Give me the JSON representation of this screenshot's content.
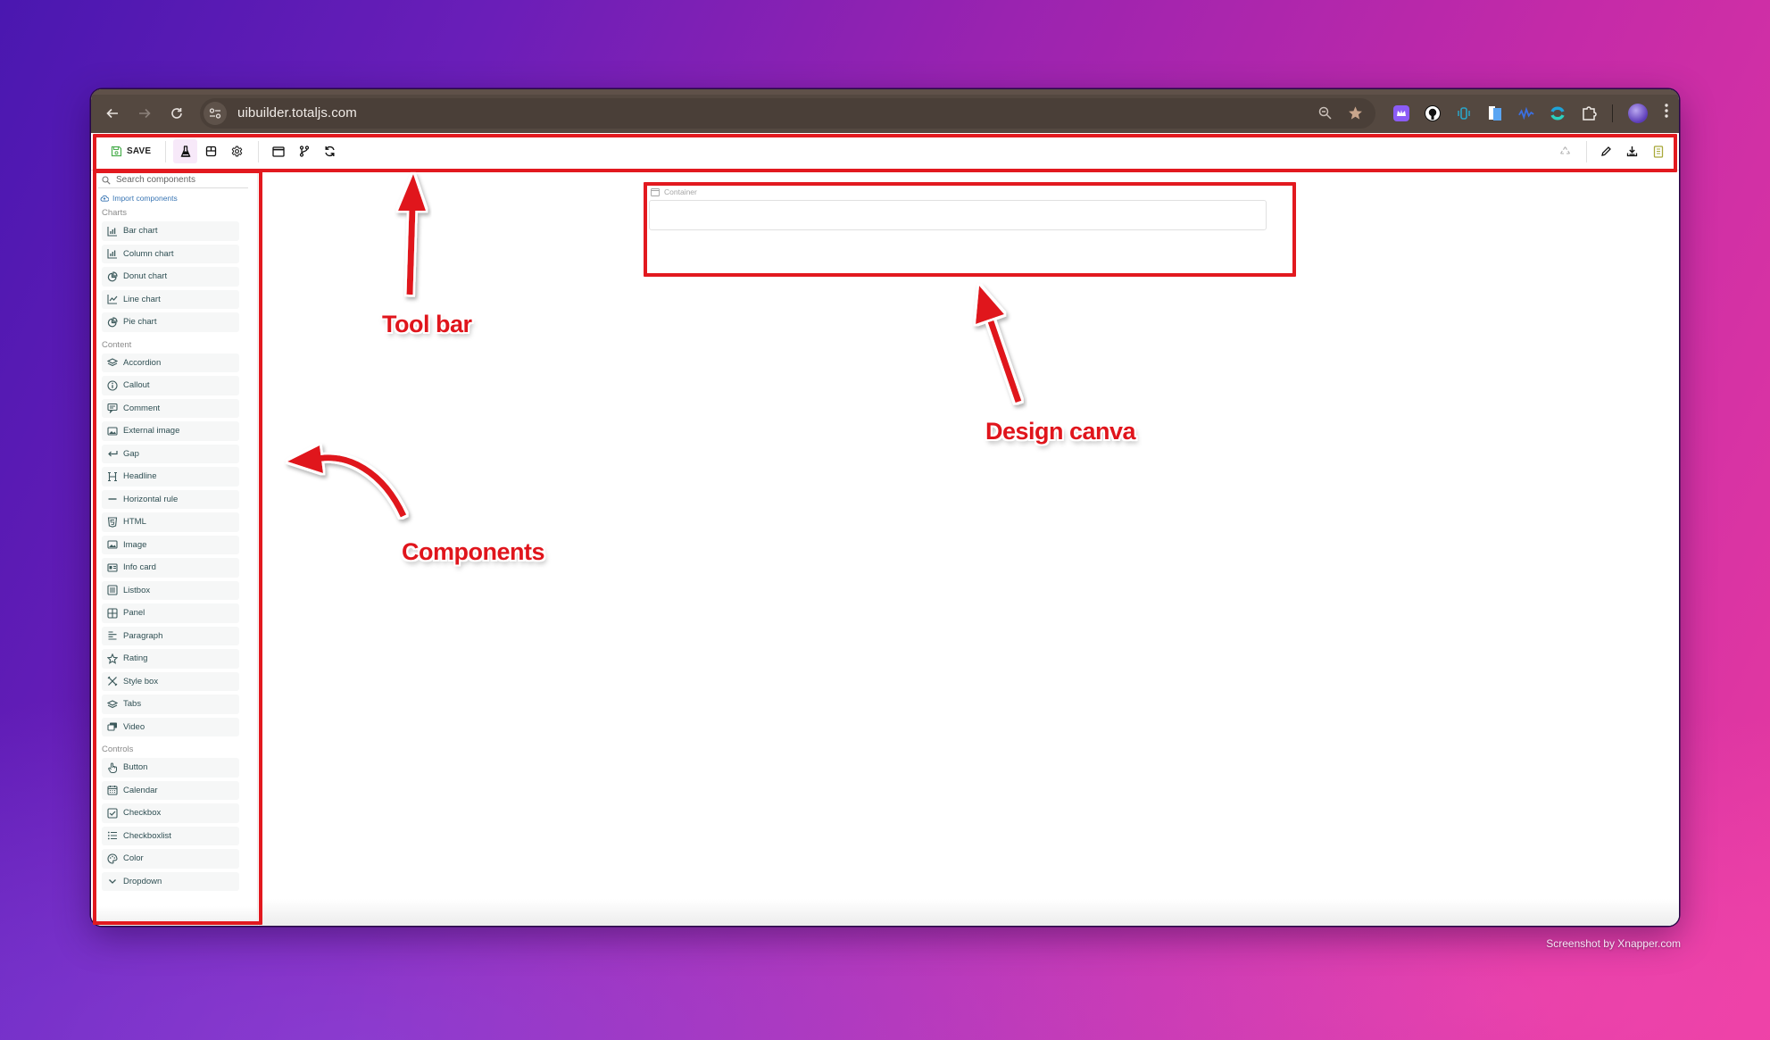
{
  "browser": {
    "url": "uibuilder.totaljs.com",
    "nav": {
      "back": "back-icon",
      "forward": "forward-icon",
      "reload": "reload-icon"
    },
    "omnibox_icons": [
      "zoom-icon",
      "bookmark-star-icon"
    ],
    "extensions": [
      {
        "name": "crown-extension",
        "color": "#8b5cf6"
      },
      {
        "name": "github-extension",
        "color": "#ffffff"
      },
      {
        "name": "vibrate-extension",
        "color": "#2aa6c9"
      },
      {
        "name": "docs-extension",
        "color": "#5aa5f2"
      },
      {
        "name": "wave-extension",
        "color": "#3b6fe0"
      },
      {
        "name": "swirl-extension",
        "color": "#1fa3d8"
      },
      {
        "name": "puzzle-extension",
        "color": "#ffffff"
      }
    ],
    "profile": "profile-avatar",
    "menu": "kebab-menu-icon"
  },
  "toolbar": {
    "save_label": "SAVE",
    "left_buttons": [
      {
        "name": "test-flask",
        "active": true
      },
      {
        "name": "store"
      },
      {
        "name": "settings"
      }
    ],
    "center_buttons": [
      {
        "name": "window"
      },
      {
        "name": "branch"
      },
      {
        "name": "refresh"
      }
    ],
    "right_buttons": [
      {
        "name": "recycle"
      },
      {
        "name": "edit-pencil"
      },
      {
        "name": "download"
      },
      {
        "name": "book"
      }
    ]
  },
  "sidebar": {
    "search_placeholder": "Search components",
    "import_label": "Import components",
    "groups": [
      {
        "title": "Charts",
        "items": [
          {
            "label": "Bar chart",
            "icon": "bar-chart"
          },
          {
            "label": "Column chart",
            "icon": "bar-chart"
          },
          {
            "label": "Donut chart",
            "icon": "pie-chart"
          },
          {
            "label": "Line chart",
            "icon": "line-chart"
          },
          {
            "label": "Pie chart",
            "icon": "pie-chart"
          }
        ]
      },
      {
        "title": "Content",
        "items": [
          {
            "label": "Accordion",
            "icon": "layers"
          },
          {
            "label": "Callout",
            "icon": "info"
          },
          {
            "label": "Comment",
            "icon": "comment"
          },
          {
            "label": "External image",
            "icon": "image"
          },
          {
            "label": "Gap",
            "icon": "return-arrow"
          },
          {
            "label": "Headline",
            "icon": "heading"
          },
          {
            "label": "Horizontal rule",
            "icon": "minus"
          },
          {
            "label": "HTML",
            "icon": "html5"
          },
          {
            "label": "Image",
            "icon": "image"
          },
          {
            "label": "Info card",
            "icon": "id-card"
          },
          {
            "label": "Listbox",
            "icon": "list-box"
          },
          {
            "label": "Panel",
            "icon": "grid"
          },
          {
            "label": "Paragraph",
            "icon": "align-left"
          },
          {
            "label": "Rating",
            "icon": "star"
          },
          {
            "label": "Style box",
            "icon": "pencil-ruler"
          },
          {
            "label": "Tabs",
            "icon": "layers"
          },
          {
            "label": "Video",
            "icon": "video"
          }
        ]
      },
      {
        "title": "Controls",
        "items": [
          {
            "label": "Button",
            "icon": "hand-pointer"
          },
          {
            "label": "Calendar",
            "icon": "calendar"
          },
          {
            "label": "Checkbox",
            "icon": "check-square"
          },
          {
            "label": "Checkboxlist",
            "icon": "list"
          },
          {
            "label": "Color",
            "icon": "palette"
          },
          {
            "label": "Dropdown",
            "icon": "chevron-down"
          }
        ]
      }
    ]
  },
  "canvas": {
    "container_label": "Container"
  },
  "annotations": {
    "toolbar": "Tool bar",
    "canvas": "Design canva",
    "components": "Components"
  },
  "credit": "Screenshot by Xnapper.com",
  "colors": {
    "highlight": "#e2191f",
    "save_icon": "#4caf50",
    "active_tool_bg": "#f7e9f9",
    "item_text": "#2f4f53",
    "link": "#3a76b4"
  }
}
